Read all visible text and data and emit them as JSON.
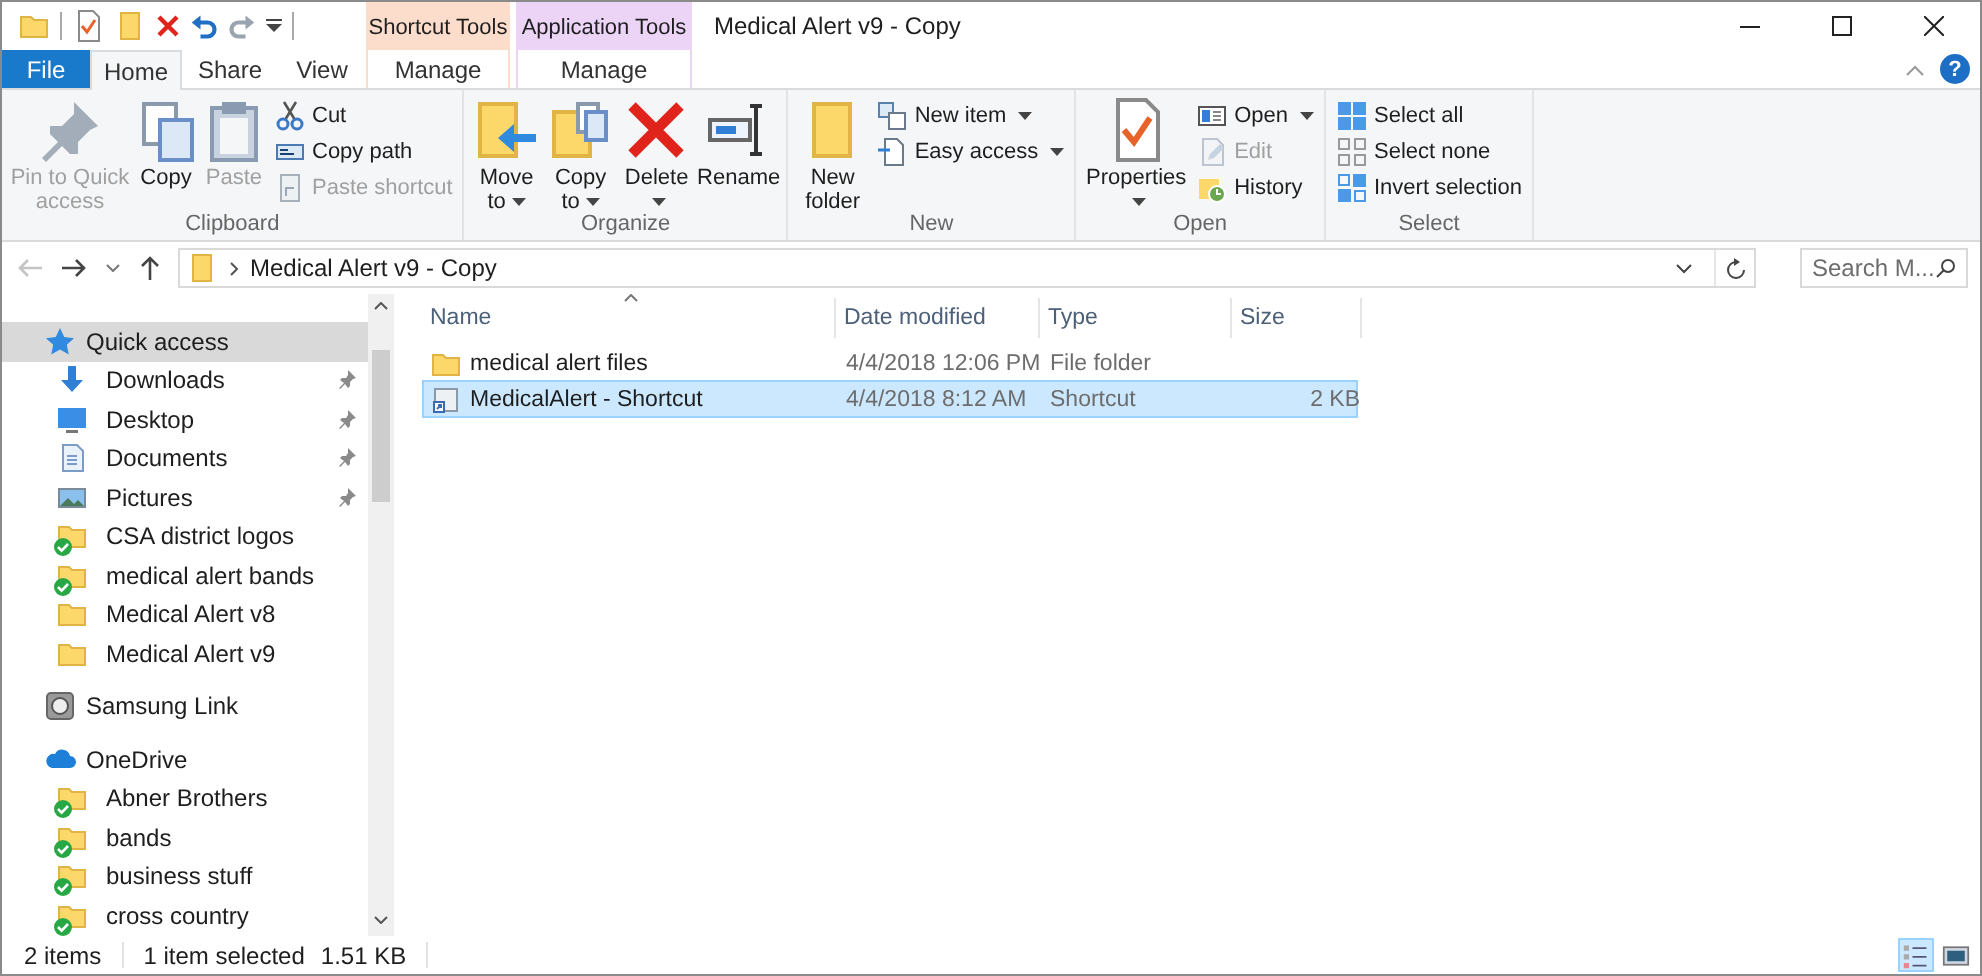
{
  "window": {
    "title": "Medical Alert v9 - Copy"
  },
  "context_tabs": [
    {
      "label": "Shortcut Tools",
      "color": "#fcdccb"
    },
    {
      "label": "Application Tools",
      "color": "#ecd4f7"
    }
  ],
  "tabs": [
    {
      "label": "File",
      "kind": "file",
      "selected": false
    },
    {
      "label": "Home",
      "kind": "plain",
      "selected": true
    },
    {
      "label": "Share",
      "kind": "plain",
      "selected": false
    },
    {
      "label": "View",
      "kind": "plain",
      "selected": false
    },
    {
      "label": "Manage",
      "kind": "context",
      "selected": false
    },
    {
      "label": "Manage",
      "kind": "context",
      "selected": false
    }
  ],
  "help_button": "?",
  "ribbon": {
    "groups": [
      {
        "name": "Clipboard",
        "commands": [
          {
            "label": "Pin to Quick access",
            "kind": "large",
            "dropdown": false,
            "disabled": true
          },
          {
            "label": "Copy",
            "kind": "large",
            "dropdown": false,
            "disabled": false
          },
          {
            "label": "Paste",
            "kind": "large",
            "dropdown": false,
            "disabled": true
          },
          {
            "label": "Cut",
            "kind": "small",
            "dropdown": false,
            "disabled": false
          },
          {
            "label": "Copy path",
            "kind": "small",
            "dropdown": false,
            "disabled": false
          },
          {
            "label": "Paste shortcut",
            "kind": "small",
            "dropdown": false,
            "disabled": true
          }
        ]
      },
      {
        "name": "Organize",
        "commands": [
          {
            "label": "Move to",
            "kind": "large",
            "dropdown": true,
            "disabled": false
          },
          {
            "label": "Copy to",
            "kind": "large",
            "dropdown": true,
            "disabled": false
          },
          {
            "label": "Delete",
            "kind": "large",
            "dropdown": true,
            "disabled": false
          },
          {
            "label": "Rename",
            "kind": "large",
            "dropdown": false,
            "disabled": false
          }
        ]
      },
      {
        "name": "New",
        "commands": [
          {
            "label": "New folder",
            "kind": "large",
            "dropdown": false,
            "disabled": false
          },
          {
            "label": "New item",
            "kind": "small",
            "dropdown": true,
            "disabled": false
          },
          {
            "label": "Easy access",
            "kind": "small",
            "dropdown": true,
            "disabled": false
          }
        ]
      },
      {
        "name": "Open",
        "commands": [
          {
            "label": "Properties",
            "kind": "large",
            "dropdown": true,
            "disabled": false
          },
          {
            "label": "Open",
            "kind": "small",
            "dropdown": true,
            "disabled": false
          },
          {
            "label": "Edit",
            "kind": "small",
            "dropdown": false,
            "disabled": true
          },
          {
            "label": "History",
            "kind": "small",
            "dropdown": false,
            "disabled": false
          }
        ]
      },
      {
        "name": "Select",
        "commands": [
          {
            "label": "Select all",
            "kind": "small",
            "dropdown": false,
            "disabled": false
          },
          {
            "label": "Select none",
            "kind": "small",
            "dropdown": false,
            "disabled": false
          },
          {
            "label": "Invert selection",
            "kind": "small",
            "dropdown": false,
            "disabled": false
          }
        ]
      }
    ]
  },
  "address": {
    "path": "Medical Alert v9 - Copy"
  },
  "search": {
    "placeholder": "Search M..."
  },
  "navigation": [
    {
      "label": "Quick access",
      "kind": "quickaccess",
      "selected": true,
      "children": [
        {
          "label": "Downloads",
          "kind": "downloads",
          "pinned": true,
          "synced": false,
          "selected": false
        },
        {
          "label": "Desktop",
          "kind": "desktop",
          "pinned": true,
          "synced": false,
          "selected": false
        },
        {
          "label": "Documents",
          "kind": "documents",
          "pinned": true,
          "synced": false,
          "selected": false
        },
        {
          "label": "Pictures",
          "kind": "pictures",
          "pinned": true,
          "synced": false,
          "selected": false
        },
        {
          "label": "CSA district logos",
          "kind": "folder",
          "pinned": false,
          "synced": true,
          "selected": false
        },
        {
          "label": "medical alert bands",
          "kind": "folder",
          "pinned": false,
          "synced": true,
          "selected": false
        },
        {
          "label": "Medical Alert v8",
          "kind": "folder",
          "pinned": false,
          "synced": false,
          "selected": false
        },
        {
          "label": "Medical Alert v9",
          "kind": "folder",
          "pinned": false,
          "synced": false,
          "selected": false
        }
      ]
    },
    {
      "label": "Samsung Link",
      "kind": "device",
      "selected": false
    },
    {
      "label": "OneDrive",
      "kind": "cloud",
      "selected": false,
      "children": [
        {
          "label": "Abner Brothers",
          "kind": "folder",
          "pinned": false,
          "synced": true,
          "selected": false
        },
        {
          "label": "bands",
          "kind": "folder",
          "pinned": false,
          "synced": true,
          "selected": false
        },
        {
          "label": "business stuff",
          "kind": "folder",
          "pinned": false,
          "synced": true,
          "selected": false
        },
        {
          "label": "cross country",
          "kind": "folder",
          "pinned": false,
          "synced": true,
          "selected": false
        }
      ]
    }
  ],
  "table": {
    "columns": [
      "Name",
      "Date modified",
      "Type",
      "Size"
    ],
    "rows": [
      {
        "name": "medical alert files",
        "kind": "folder",
        "date_modified": "4/4/2018 12:06 PM",
        "type": "File folder",
        "selected": false
      },
      {
        "name": "MedicalAlert - Shortcut",
        "kind": "shortcut",
        "date_modified": "4/4/2018 8:12 AM",
        "type": "Shortcut",
        "size": "2 KB",
        "selected": true
      }
    ]
  },
  "status_bar": {
    "item_count": "2 items",
    "selection": "1 item selected",
    "selection_size": "1.51 KB",
    "views": [
      {
        "kind": "details",
        "selected": true
      },
      {
        "kind": "tiles",
        "selected": false
      }
    ]
  }
}
